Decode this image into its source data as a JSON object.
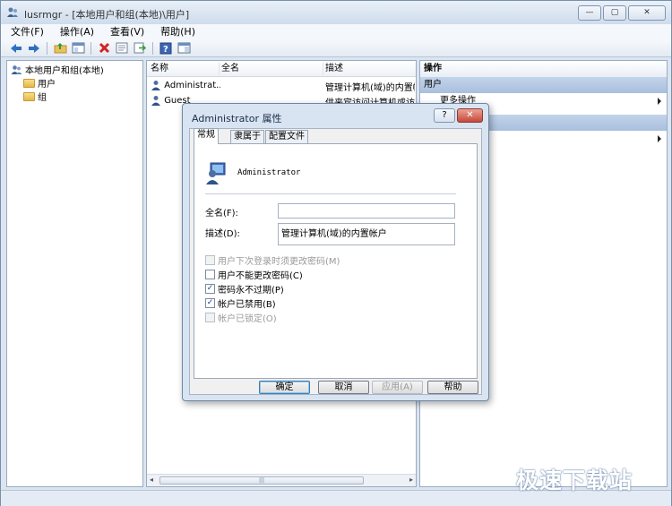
{
  "window": {
    "title": "lusrmgr - [本地用户和组(本地)\\用户]",
    "minimize": "—",
    "maximize": "▢",
    "close": "✕"
  },
  "menu": [
    "文件(F)",
    "操作(A)",
    "查看(V)",
    "帮助(H)"
  ],
  "tree": {
    "root": "本地用户和组(本地)",
    "children": [
      "用户",
      "组"
    ]
  },
  "list": {
    "columns": [
      "名称",
      "全名",
      "描述"
    ],
    "rows": [
      {
        "name": "Administrat...",
        "fullname": "",
        "desc": "管理计算机(域)的内置帐"
      },
      {
        "name": "Guest",
        "fullname": "",
        "desc": "供来宾访问计算机或访问"
      }
    ],
    "scroll_left": "◂",
    "scroll_right": "▸",
    "thumb_grip": "|||"
  },
  "actions": {
    "header": "操作",
    "group1": "用户",
    "group1_item": "更多操作"
  },
  "dialog": {
    "title": "Administrator 属性",
    "help": "?",
    "close": "✕",
    "tabs": [
      "常规",
      "隶属于",
      "配置文件"
    ],
    "account": "Administrator",
    "fullname_label": "全名(F):",
    "fullname_value": "",
    "desc_label": "描述(D):",
    "desc_value": "管理计算机(域)的内置帐户",
    "checkboxes": [
      {
        "label": "用户下次登录时须更改密码(M)",
        "checked": false,
        "disabled": true
      },
      {
        "label": "用户不能更改密码(C)",
        "checked": false,
        "disabled": false
      },
      {
        "label": "密码永不过期(P)",
        "checked": true,
        "disabled": false
      },
      {
        "label": "帐户已禁用(B)",
        "checked": true,
        "disabled": false
      },
      {
        "label": "帐户已锁定(O)",
        "checked": false,
        "disabled": true
      }
    ],
    "check_mark": "✓",
    "buttons": {
      "ok": "确定",
      "cancel": "取消",
      "apply": "应用(A)",
      "help": "帮助"
    }
  },
  "watermark": "极速下载站"
}
